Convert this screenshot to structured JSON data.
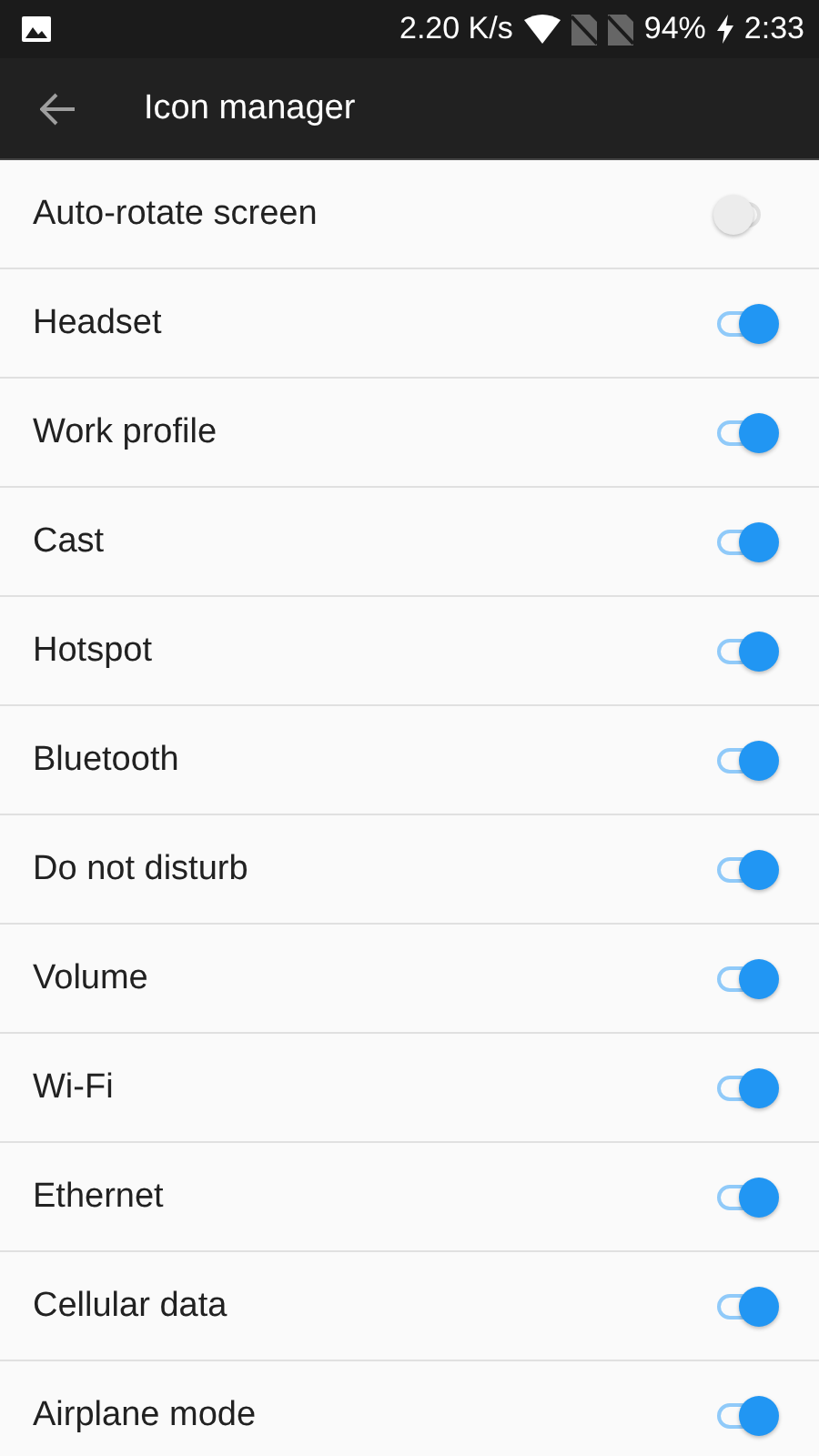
{
  "status_bar": {
    "speed": "2.20 K/s",
    "battery": "94%",
    "time": "2:33"
  },
  "toolbar": {
    "title": "Icon manager"
  },
  "items": [
    {
      "label": "Auto-rotate screen",
      "on": false
    },
    {
      "label": "Headset",
      "on": true
    },
    {
      "label": "Work profile",
      "on": true
    },
    {
      "label": "Cast",
      "on": true
    },
    {
      "label": "Hotspot",
      "on": true
    },
    {
      "label": "Bluetooth",
      "on": true
    },
    {
      "label": "Do not disturb",
      "on": true
    },
    {
      "label": "Volume",
      "on": true
    },
    {
      "label": "Wi-Fi",
      "on": true
    },
    {
      "label": "Ethernet",
      "on": true
    },
    {
      "label": "Cellular data",
      "on": true
    },
    {
      "label": "Airplane mode",
      "on": true
    }
  ]
}
